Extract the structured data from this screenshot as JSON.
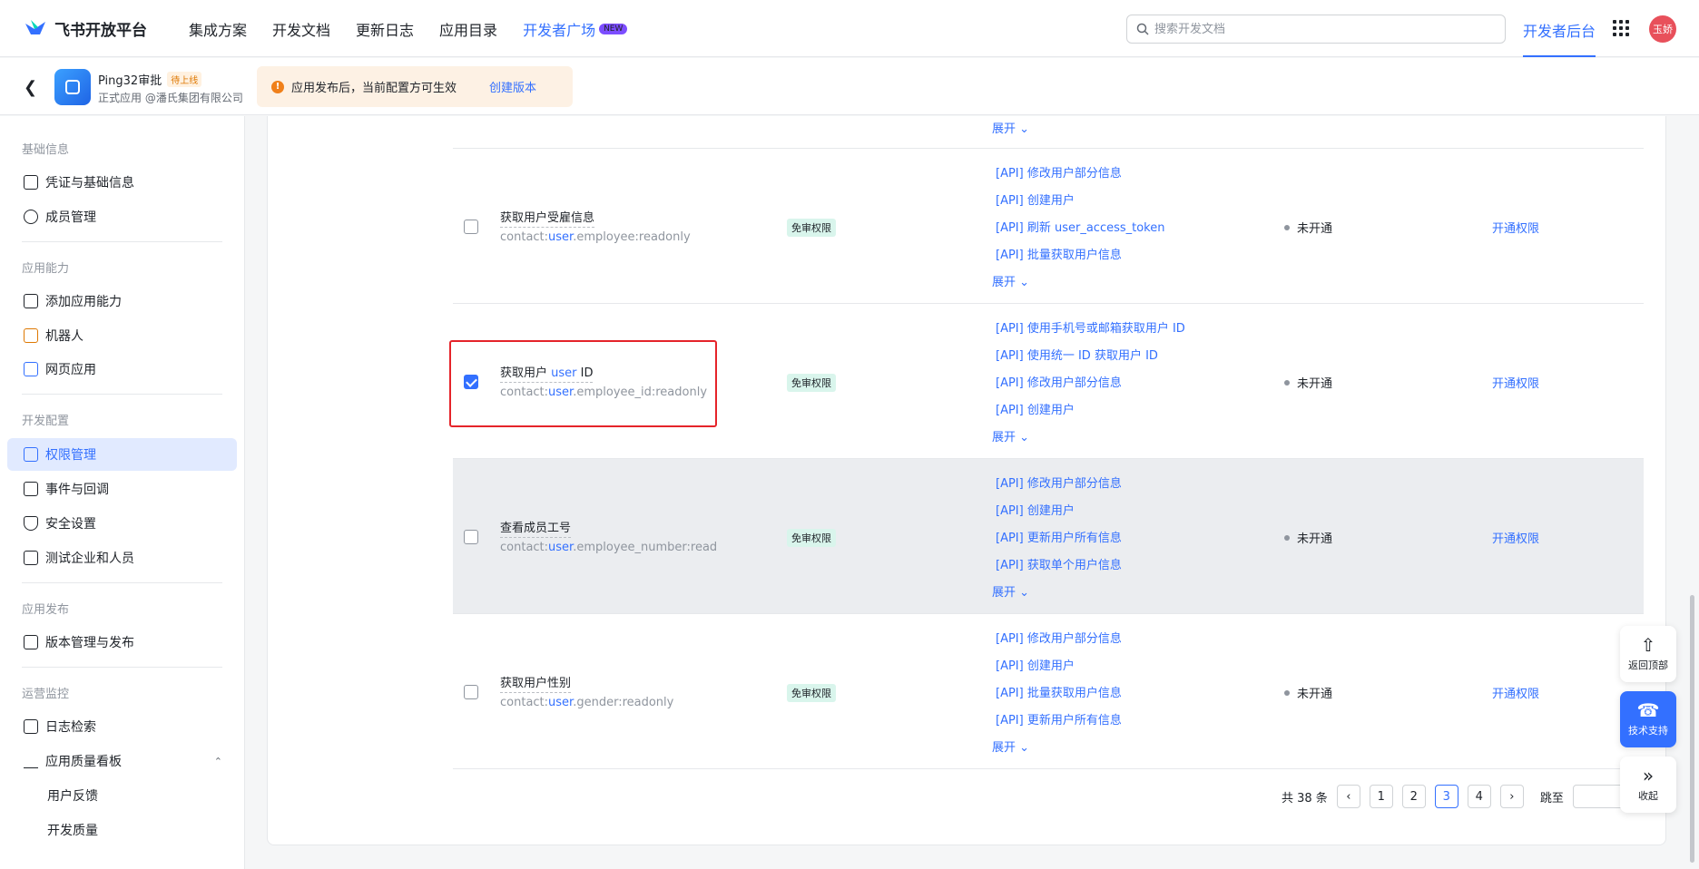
{
  "topbar": {
    "logo": "飞书开放平台",
    "nav": [
      "集成方案",
      "开发文档",
      "更新日志",
      "应用目录"
    ],
    "nav_active": "开发者广场",
    "new_badge": "NEW",
    "search_placeholder": "搜索开发文档",
    "dev_console": "开发者后台",
    "avatar": "玉娇"
  },
  "appbar": {
    "app_name": "Ping32审批",
    "status": "待上线",
    "sub": "正式应用 @潘氏集团有限公司",
    "notice": "应用发布后，当前配置方可生效",
    "notice_link": "创建版本"
  },
  "sidebar": {
    "sections": [
      {
        "title": "基础信息",
        "items": [
          "凭证与基础信息",
          "成员管理"
        ]
      },
      {
        "title": "应用能力",
        "items": [
          "添加应用能力",
          "机器人",
          "网页应用"
        ]
      },
      {
        "title": "开发配置",
        "items": [
          "权限管理",
          "事件与回调",
          "安全设置",
          "测试企业和人员"
        ]
      },
      {
        "title": "应用发布",
        "items": [
          "版本管理与发布"
        ]
      },
      {
        "title": "运营监控",
        "items": [
          "日志检索",
          "应用质量看板",
          "用户反馈",
          "开发质量"
        ]
      }
    ],
    "active_item": "权限管理"
  },
  "table": {
    "expand_label": "展开",
    "rows": [
      {
        "name": "获取用户受雇信息",
        "name_parts": [
          "获取用户受雇信息",
          "",
          ""
        ],
        "code_prefix": "contact:",
        "code_hi": "user",
        "code_suffix": ".employee:readonly",
        "tag": "免审权限",
        "apis": [
          "[API] 修改用户部分信息",
          "[API] 创建用户",
          "[API] 刷新 user_access_token",
          "[API] 批量获取用户信息"
        ],
        "status": "未开通",
        "action": "开通权限",
        "checked": false
      },
      {
        "name_parts": [
          "获取用户 ",
          "user",
          " ID"
        ],
        "code_prefix": "contact:",
        "code_hi": "user",
        "code_suffix": ".employee_id:readonly",
        "tag": "免审权限",
        "apis": [
          "[API] 使用手机号或邮箱获取用户 ID",
          "[API] 使用统一 ID 获取用户 ID",
          "[API] 修改用户部分信息",
          "[API] 创建用户"
        ],
        "status": "未开通",
        "action": "开通权限",
        "checked": true
      },
      {
        "name_parts": [
          "查看成员工号",
          "",
          ""
        ],
        "code_prefix": "contact:",
        "code_hi": "user",
        "code_suffix": ".employee_number:read",
        "tag": "免审权限",
        "apis": [
          "[API] 修改用户部分信息",
          "[API] 创建用户",
          "[API] 更新用户所有信息",
          "[API] 获取单个用户信息"
        ],
        "status": "未开通",
        "action": "开通权限",
        "checked": false
      },
      {
        "name_parts": [
          "获取用户性别",
          "",
          ""
        ],
        "code_prefix": "contact:",
        "code_hi": "user",
        "code_suffix": ".gender:readonly",
        "tag": "免审权限",
        "apis": [
          "[API] 修改用户部分信息",
          "[API] 创建用户",
          "[API] 批量获取用户信息",
          "[API] 更新用户所有信息"
        ],
        "status": "未开通",
        "action": "开通权限",
        "checked": false
      }
    ]
  },
  "pagination": {
    "total": "共 38 条",
    "pages": [
      "1",
      "2",
      "3",
      "4"
    ],
    "current": "3",
    "jump": "跳至"
  },
  "fabs": {
    "top": "返回顶部",
    "support": "技术支持",
    "collapse": "收起"
  },
  "colors": {
    "accent": "#3370ff",
    "highlight_box": "#e5242a"
  }
}
